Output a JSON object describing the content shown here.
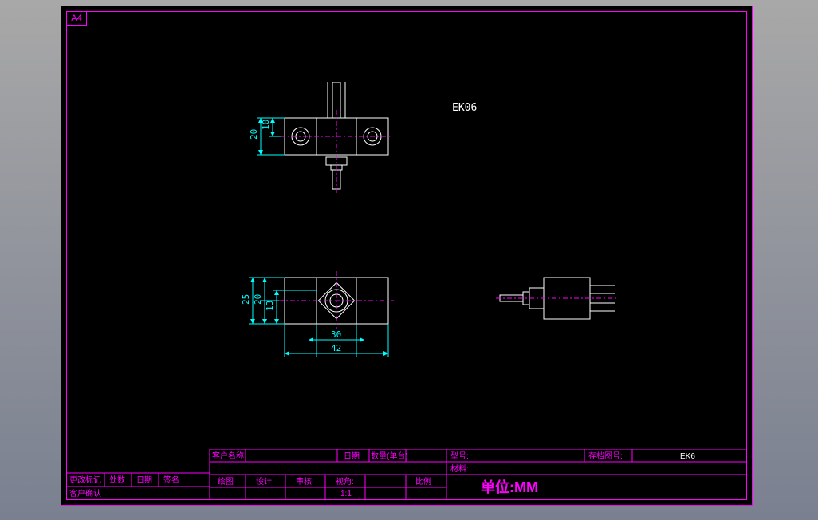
{
  "frame": {
    "format": "A4"
  },
  "part": {
    "label": "EK06"
  },
  "dimensions": {
    "top_view": {
      "d1": "10",
      "d2": "20"
    },
    "bottom_view": {
      "d1": "13",
      "d2": "20",
      "d3": "25",
      "w1": "30",
      "w2": "42"
    }
  },
  "titleblock": {
    "revision": {
      "mark": "更改标记",
      "count": "处数",
      "date": "日期",
      "sign": "签名",
      "confirm": "客户确认"
    },
    "headers": {
      "customer": "客户名称",
      "date": "日期",
      "qty": "数量(单台)",
      "model": "型号:",
      "archive": "存档图号:",
      "material": "材料:",
      "drawn": "绘图",
      "design": "设计",
      "review": "审核",
      "view": "视角:",
      "scale": "比例",
      "scale_val": "1:1"
    },
    "archive_no": "EK6",
    "units": "单位:MM"
  }
}
